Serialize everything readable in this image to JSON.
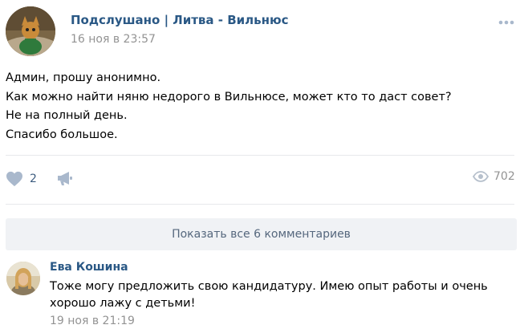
{
  "post": {
    "group_name": "Подслушано | Литва - Вильнюс",
    "date": "16 ноя в 23:57",
    "text_lines": [
      "Админ, прошу анонимно.",
      "Как можно найти няню недорого в Вильнюсе, может кто то даст совет?",
      "Не на полный день.",
      "Спасибо большое."
    ],
    "likes": "2",
    "views": "702",
    "icons": {
      "more": "more-dots-icon",
      "like": "heart-icon",
      "share": "megaphone-icon",
      "views": "eye-icon"
    }
  },
  "comments": {
    "show_all_label": "Показать все 6 комментариев",
    "items": [
      {
        "author": "Ева Кошина",
        "text": "Тоже могу предложить свою кандидатуру. Имею опыт работы и очень хорошо лажу с детьми!",
        "date": "19 ноя в 21:19"
      }
    ]
  },
  "colors": {
    "link": "#2a5885",
    "meta": "#939393",
    "icon": "#a9b8cc",
    "button_bg": "#f0f2f5",
    "button_text": "#55677d",
    "divider": "#e7e8ec"
  }
}
